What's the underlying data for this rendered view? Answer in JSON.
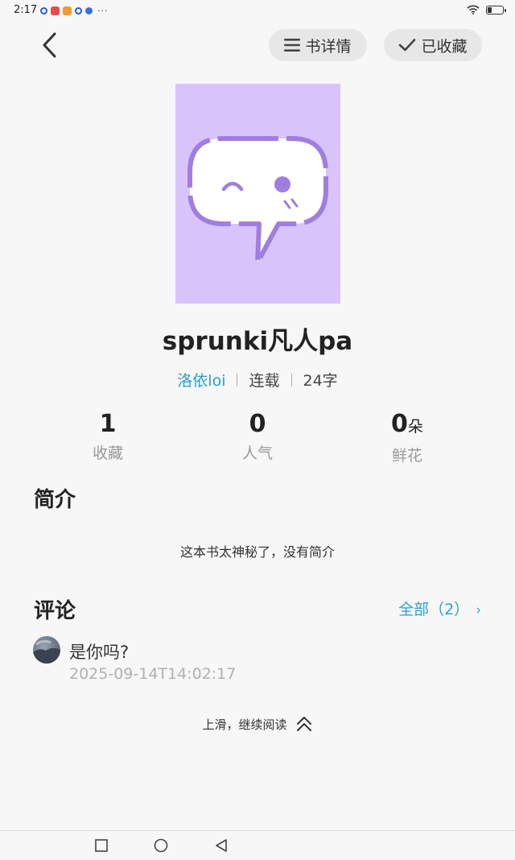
{
  "status_bar": {
    "time": "2:17",
    "more": "···"
  },
  "header": {
    "details_label": "书详情",
    "favorited_label": "已收藏"
  },
  "book": {
    "title": "sprunki凡人pa",
    "author": "洛依loi",
    "status": "连载",
    "word_count": "24字"
  },
  "stats": [
    {
      "value": "1",
      "unit": "",
      "label": "收藏"
    },
    {
      "value": "0",
      "unit": "",
      "label": "人气"
    },
    {
      "value": "0",
      "unit": "朵",
      "label": "鲜花"
    }
  ],
  "intro": {
    "title": "简介",
    "text": "这本书太神秘了，没有简介"
  },
  "comments": {
    "title": "评论",
    "all_label": "全部（2）",
    "items": [
      {
        "text": "是你吗?",
        "time": "2025-09-14T14:02:17"
      }
    ]
  },
  "swipe_hint": "上滑，继续阅读",
  "colors": {
    "accent": "#2a9fd6",
    "cover_bg": "#d8c4fb",
    "cover_icon": "#a07ee0"
  }
}
